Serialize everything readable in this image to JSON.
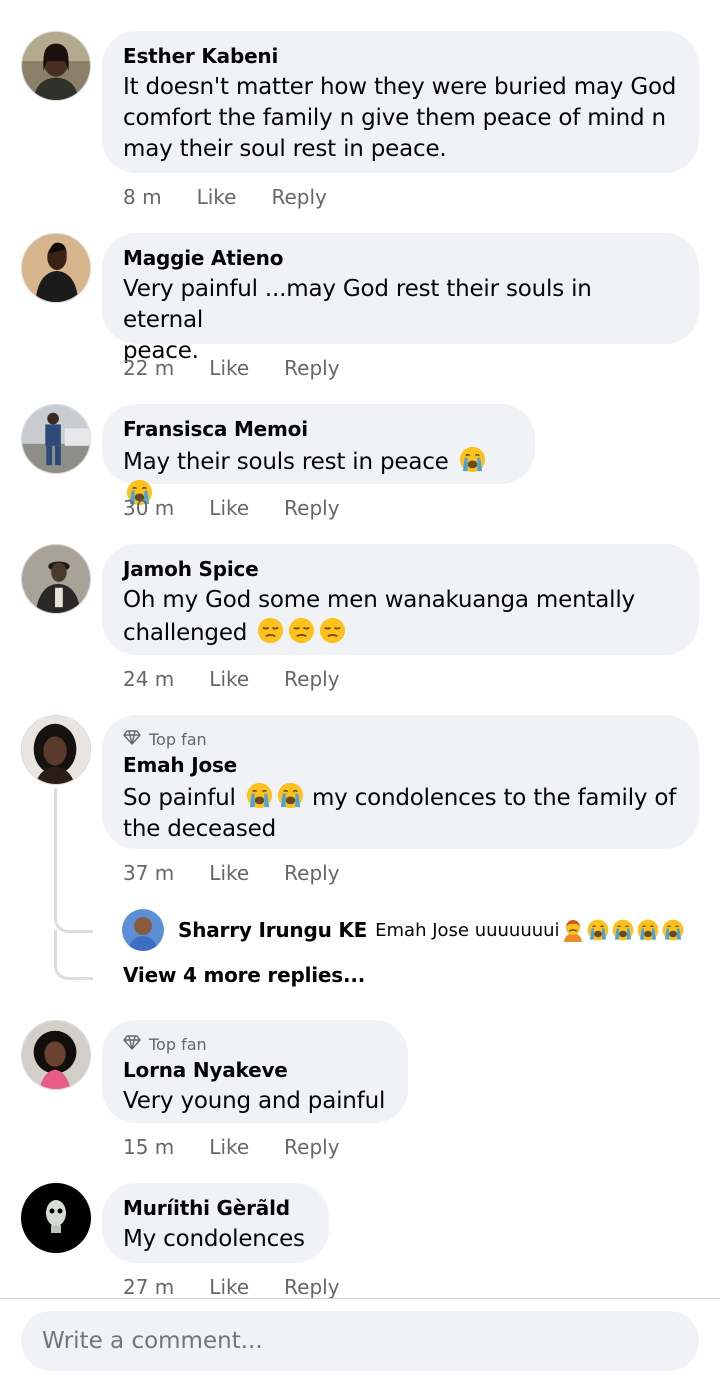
{
  "comments": [
    {
      "name": "Esther Kabeni",
      "lines": [
        "It doesn't matter how they were buried may God",
        "comfort the family n give them peace of mind n",
        "may their soul rest in peace."
      ],
      "time": "8 m",
      "like": "Like",
      "reply": "Reply"
    },
    {
      "name": "Maggie Atieno",
      "lines": [
        "Very painful ...may God rest their souls in eternal",
        "peace."
      ],
      "time": "22 m",
      "like": "Like",
      "reply": "Reply"
    },
    {
      "name": "Fransisca Memoi",
      "lines": [
        "May their souls rest in peace"
      ],
      "emojis": [
        "loudly-crying-face",
        "loudly-crying-face"
      ],
      "time": "30 m",
      "like": "Like",
      "reply": "Reply"
    },
    {
      "name": "Jamoh Spice",
      "lines": [
        "Oh my God some men wanakuanga mentally",
        "challenged"
      ],
      "emojis": [
        "pensive-face",
        "pensive-face",
        "pensive-face"
      ],
      "time": "24 m",
      "like": "Like",
      "reply": "Reply"
    },
    {
      "badge": "Top fan",
      "name": "Emah Jose",
      "lines": [
        "So painful",
        "my condolences to the family of",
        "the deceased"
      ],
      "emojis": [
        "loudly-crying-face",
        "loudly-crying-face"
      ],
      "time": "37 m",
      "like": "Like",
      "reply": "Reply"
    },
    {
      "badge": "Top fan",
      "name": "Lorna Nyakeve",
      "lines": [
        "Very young and painful"
      ],
      "time": "15 m",
      "like": "Like",
      "reply": "Reply"
    },
    {
      "name": "Muríithi Gèrãld",
      "lines": [
        "My condolences"
      ],
      "time": "27 m",
      "like": "Like",
      "reply": "Reply"
    }
  ],
  "reply_preview": {
    "name": "Sharry Irungu KE",
    "text": "Emah Jose uuuuuuui",
    "emojis": [
      "person-pouting",
      "loudly-crying-face",
      "loudly-crying-face",
      "loudly-crying-face",
      "loudly-crying-face"
    ]
  },
  "view_more": "View 4 more replies...",
  "composer": {
    "placeholder": "Write a comment..."
  },
  "icons": {
    "top_fan": "diamond-icon"
  },
  "colors": {
    "bubble": "#f0f2f5",
    "secondary_text": "#65676b",
    "divider": "#ced0d4"
  }
}
